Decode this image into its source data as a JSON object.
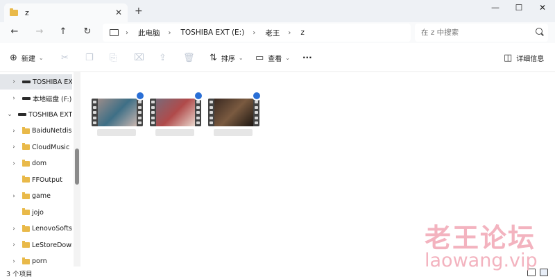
{
  "tab": {
    "title": "z",
    "close": "✕",
    "new": "+"
  },
  "window_controls": {
    "minimize": "—",
    "maximize": "☐",
    "close": "✕"
  },
  "nav": {
    "back": "←",
    "forward": "→",
    "up": "↑",
    "refresh": "↻"
  },
  "breadcrumb": [
    "此电脑",
    "TOSHIBA EXT (E:)",
    "老王",
    "z"
  ],
  "breadcrumb_separator": "›",
  "search": {
    "placeholder": "在 z 中搜索"
  },
  "toolbar": {
    "new_label": "新建",
    "sort_label": "排序",
    "view_label": "查看",
    "more_label": "···",
    "details_label": "详细信息"
  },
  "sidebar": {
    "items": [
      {
        "label": "TOSHIBA EXT",
        "type": "drive",
        "chevron": "›",
        "selected": true
      },
      {
        "label": "本地磁盘 (F:)",
        "type": "drive",
        "chevron": "›"
      },
      {
        "label": "TOSHIBA EXT (",
        "type": "drive",
        "chevron": "⌄"
      },
      {
        "label": "BaiduNetdiskD",
        "type": "folder",
        "chevron": "›"
      },
      {
        "label": "CloudMusic",
        "type": "folder",
        "chevron": "›"
      },
      {
        "label": "dom",
        "type": "folder",
        "chevron": "›"
      },
      {
        "label": "FFOutput",
        "type": "folder",
        "chevron": ""
      },
      {
        "label": "game",
        "type": "folder",
        "chevron": "›"
      },
      {
        "label": "jojo",
        "type": "folder",
        "chevron": ""
      },
      {
        "label": "LenovoSoftsto",
        "type": "folder",
        "chevron": "›"
      },
      {
        "label": "LeStoreDownl",
        "type": "folder",
        "chevron": "›"
      },
      {
        "label": "porn",
        "type": "folder",
        "chevron": "›"
      }
    ]
  },
  "files": [
    {
      "thumb_colors": [
        "#9a8c8a",
        "#3e6f86",
        "#c9b6b0"
      ]
    },
    {
      "thumb_colors": [
        "#7a6a78",
        "#b04a4a",
        "#e8d6cc"
      ]
    },
    {
      "thumb_colors": [
        "#3b2a22",
        "#7a5a40",
        "#1e1712"
      ]
    }
  ],
  "status": {
    "item_count": "3 个项目"
  },
  "watermark": {
    "cn": "老王论坛",
    "en": "laowang.vip"
  },
  "colors": {
    "accent": "#2a6fd6",
    "folder": "#e9b949",
    "watermark": "#f3b3bf"
  }
}
